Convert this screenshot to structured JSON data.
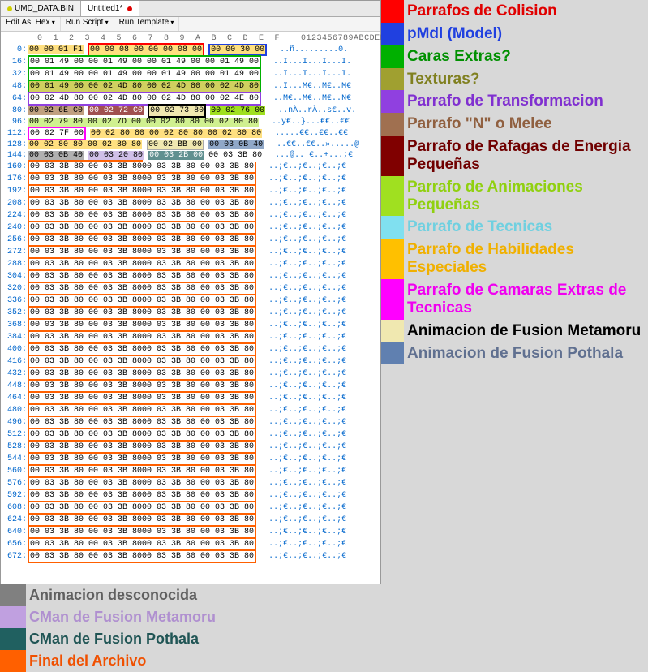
{
  "tabs": [
    "UMD_DATA.BIN",
    "Untitled1*"
  ],
  "toolbar": [
    "Edit As: Hex",
    "Run Script",
    "Run Template"
  ],
  "col_header": "  0  1  2  3  4  5  6  7  8  9  A  B  C  D  E  F    0123456789ABCDEF",
  "hex_rows": [
    {
      "o": "0:",
      "h": "00 00 01 F1 00 00 08 00 00 00 08 00 00 00 30 00",
      "a": "..ñ.........0."
    },
    {
      "o": "16:",
      "h": "00 01 49 00 00 01 49 00 00 01 49 00 00 01 49 00",
      "a": "..I...I...I...I."
    },
    {
      "o": "32:",
      "h": "00 01 49 00 00 01 49 00 00 01 49 00 00 01 49 00",
      "a": "..I...I...I...I."
    },
    {
      "o": "48:",
      "h": "00 01 49 00 00 02 4D 80 00 02 4D 80 00 02 4D 80",
      "a": "..I...M€..M€..M€"
    },
    {
      "o": "64:",
      "h": "00 02 4D 80 00 02 4D 80 00 02 4D 80 00 02 4E 80",
      "a": "..M€..M€..M€..N€"
    },
    {
      "o": "80:",
      "h": "00 02 6E C0 00 02 72 C0 00 02 73 80 00 02 76 00",
      "a": "..nÀ..rÀ..s€..v."
    },
    {
      "o": "96:",
      "h": "00 02 79 80 00 02 7D 00 00 02 80 80 00 02 80 80",
      "a": "..y€..}...€€..€€"
    },
    {
      "o": "112:",
      "h": "00 02 7F 00 00 02 80 80 00 02 80 80 00 02 80 80",
      "a": ".....€€..€€..€€"
    },
    {
      "o": "128:",
      "h": "00 02 80 80 00 02 80 80 00 02 BB 00 00 03 0B 40",
      "a": "..€€..€€..».....@"
    },
    {
      "o": "144:",
      "h": "00 03 0B 40 00 03 20 80 00 03 2B 00 00 03 3B 80",
      "a": "...@.. €..+...;€"
    },
    {
      "o": "160:",
      "h": "00 03 3B 80 00 03 3B 80 00 03 3B 80 00 03 3B 80",
      "a": "..;€..;€..;€..;€"
    },
    {
      "o": "176:",
      "h": "00 03 3B 80 00 03 3B 80 00 03 3B 80 00 03 3B 80",
      "a": "..;€..;€..;€..;€"
    },
    {
      "o": "192:",
      "h": "00 03 3B 80 00 03 3B 80 00 03 3B 80 00 03 3B 80",
      "a": "..;€..;€..;€..;€"
    },
    {
      "o": "208:",
      "h": "00 03 3B 80 00 03 3B 80 00 03 3B 80 00 03 3B 80",
      "a": "..;€..;€..;€..;€"
    },
    {
      "o": "224:",
      "h": "00 03 3B 80 00 03 3B 80 00 03 3B 80 00 03 3B 80",
      "a": "..;€..;€..;€..;€"
    },
    {
      "o": "240:",
      "h": "00 03 3B 80 00 03 3B 80 00 03 3B 80 00 03 3B 80",
      "a": "..;€..;€..;€..;€"
    },
    {
      "o": "256:",
      "h": "00 03 3B 80 00 03 3B 80 00 03 3B 80 00 03 3B 80",
      "a": "..;€..;€..;€..;€"
    },
    {
      "o": "272:",
      "h": "00 03 3B 80 00 03 3B 80 00 03 3B 80 00 03 3B 80",
      "a": "..;€..;€..;€..;€"
    },
    {
      "o": "288:",
      "h": "00 03 3B 80 00 03 3B 80 00 03 3B 80 00 03 3B 80",
      "a": "..;€..;€..;€..;€"
    },
    {
      "o": "304:",
      "h": "00 03 3B 80 00 03 3B 80 00 03 3B 80 00 03 3B 80",
      "a": "..;€..;€..;€..;€"
    },
    {
      "o": "320:",
      "h": "00 03 3B 80 00 03 3B 80 00 03 3B 80 00 03 3B 80",
      "a": "..;€..;€..;€..;€"
    },
    {
      "o": "336:",
      "h": "00 03 3B 80 00 03 3B 80 00 03 3B 80 00 03 3B 80",
      "a": "..;€..;€..;€..;€"
    },
    {
      "o": "352:",
      "h": "00 03 3B 80 00 03 3B 80 00 03 3B 80 00 03 3B 80",
      "a": "..;€..;€..;€..;€"
    },
    {
      "o": "368:",
      "h": "00 03 3B 80 00 03 3B 80 00 03 3B 80 00 03 3B 80",
      "a": "..;€..;€..;€..;€"
    },
    {
      "o": "384:",
      "h": "00 03 3B 80 00 03 3B 80 00 03 3B 80 00 03 3B 80",
      "a": "..;€..;€..;€..;€"
    },
    {
      "o": "400:",
      "h": "00 03 3B 80 00 03 3B 80 00 03 3B 80 00 03 3B 80",
      "a": "..;€..;€..;€..;€"
    },
    {
      "o": "416:",
      "h": "00 03 3B 80 00 03 3B 80 00 03 3B 80 00 03 3B 80",
      "a": "..;€..;€..;€..;€"
    },
    {
      "o": "432:",
      "h": "00 03 3B 80 00 03 3B 80 00 03 3B 80 00 03 3B 80",
      "a": "..;€..;€..;€..;€"
    },
    {
      "o": "448:",
      "h": "00 03 3B 80 00 03 3B 80 00 03 3B 80 00 03 3B 80",
      "a": "..;€..;€..;€..;€"
    },
    {
      "o": "464:",
      "h": "00 03 3B 80 00 03 3B 80 00 03 3B 80 00 03 3B 80",
      "a": "..;€..;€..;€..;€"
    },
    {
      "o": "480:",
      "h": "00 03 3B 80 00 03 3B 80 00 03 3B 80 00 03 3B 80",
      "a": "..;€..;€..;€..;€"
    },
    {
      "o": "496:",
      "h": "00 03 3B 80 00 03 3B 80 00 03 3B 80 00 03 3B 80",
      "a": "..;€..;€..;€..;€"
    },
    {
      "o": "512:",
      "h": "00 03 3B 80 00 03 3B 80 00 03 3B 80 00 03 3B 80",
      "a": "..;€..;€..;€..;€"
    },
    {
      "o": "528:",
      "h": "00 03 3B 80 00 03 3B 80 00 03 3B 80 00 03 3B 80",
      "a": "..;€..;€..;€..;€"
    },
    {
      "o": "544:",
      "h": "00 03 3B 80 00 03 3B 80 00 03 3B 80 00 03 3B 80",
      "a": "..;€..;€..;€..;€"
    },
    {
      "o": "560:",
      "h": "00 03 3B 80 00 03 3B 80 00 03 3B 80 00 03 3B 80",
      "a": "..;€..;€..;€..;€"
    },
    {
      "o": "576:",
      "h": "00 03 3B 80 00 03 3B 80 00 03 3B 80 00 03 3B 80",
      "a": "..;€..;€..;€..;€"
    },
    {
      "o": "592:",
      "h": "00 03 3B 80 00 03 3B 80 00 03 3B 80 00 03 3B 80",
      "a": "..;€..;€..;€..;€"
    },
    {
      "o": "608:",
      "h": "00 03 3B 80 00 03 3B 80 00 03 3B 80 00 03 3B 80",
      "a": "..;€..;€..;€..;€"
    },
    {
      "o": "624:",
      "h": "00 03 3B 80 00 03 3B 80 00 03 3B 80 00 03 3B 80",
      "a": "..;€..;€..;€..;€"
    },
    {
      "o": "640:",
      "h": "00 03 3B 80 00 03 3B 80 00 03 3B 80 00 03 3B 80",
      "a": "..;€..;€..;€..;€"
    },
    {
      "o": "656:",
      "h": "00 03 3B 80 00 03 3B 80 00 03 3B 80 00 03 3B 80",
      "a": "..;€..;€..;€..;€"
    },
    {
      "o": "672:",
      "h": "00 03 3B 80 00 03 3B 80 00 03 3B 80 00 03 3B 80",
      "a": "..;€..;€..;€..;€"
    }
  ],
  "legend_right": [
    {
      "c": "red",
      "t": "red",
      "label": "Parrafos de Colision"
    },
    {
      "c": "blue",
      "t": "blue",
      "label": "pMdl (Model)"
    },
    {
      "c": "green",
      "t": "green",
      "label": "Caras Extras?"
    },
    {
      "c": "olive",
      "t": "olive",
      "label": "Texturas?"
    },
    {
      "c": "purple",
      "t": "purple",
      "label": "Parrafo de Transformacion"
    },
    {
      "c": "brown",
      "t": "brown",
      "label": "Parrafo \"N\" o Melee"
    },
    {
      "c": "darkred",
      "t": "darkred",
      "label": "Parrafo de Rafagas de Energia Pequeñas"
    },
    {
      "c": "lime",
      "t": "lime",
      "label": "Parrafo de Animaciones Pequeñas"
    },
    {
      "c": "cyan",
      "t": "cyan",
      "label": "Parrafo de Tecnicas"
    },
    {
      "c": "yellow",
      "t": "yellow",
      "label": "Parrafo de Habilidades Especiales"
    },
    {
      "c": "magenta",
      "t": "magenta",
      "label": "Parrafo de Camaras Extras de Tecnicas"
    },
    {
      "c": "cream",
      "t": "black",
      "label": "Animacion de Fusion Metamoru"
    },
    {
      "c": "steelblue",
      "t": "steelblue",
      "label": "Animacion de Fusion Pothala"
    }
  ],
  "legend_bottom": [
    {
      "c": "gray",
      "t": "gray",
      "label": "Animacion desconocida"
    },
    {
      "c": "lavender",
      "t": "lavender",
      "label": "CMan de Fusion Metamoru"
    },
    {
      "c": "teal",
      "t": "teal",
      "label": "CMan de Fusion Pothala"
    },
    {
      "c": "orange",
      "t": "orange",
      "label": "Final del Archivo"
    }
  ],
  "highlight_map": {
    "colors": {
      "row0_seg1": "#ffe080",
      "row0_seg2_border": "#ff0000",
      "row0_seg3": "#2040e0",
      "row1_border": "#00b000",
      "row3_bg": "#a0a030",
      "row4_border": "#9040e0",
      "row5_seg1": "#a07050",
      "row5_seg2": "#800000",
      "row5_seg3_border": "#000",
      "row6_bg": "#a0e020",
      "row7_border": "#ff00ff",
      "row8_seg_c": "#f0e8b0",
      "row8_seg_d": "#6080b0",
      "row9_bg": "#808080",
      "final_orange_border": "#ff6000"
    }
  }
}
